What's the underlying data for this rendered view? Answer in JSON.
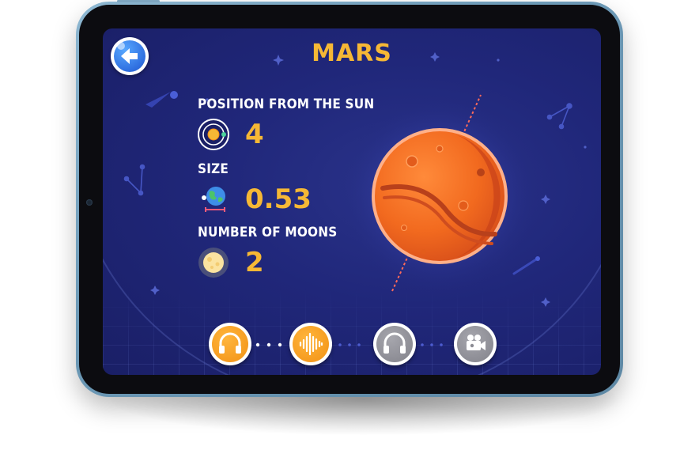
{
  "screen": {
    "title": "MARS",
    "back_icon": "arrow-left-icon",
    "stats": [
      {
        "label": "POSITION FROM THE SUN",
        "value": "4",
        "icon": "orbit-sun-icon"
      },
      {
        "label": "SIZE",
        "value": "0.53",
        "icon": "earth-scale-icon"
      },
      {
        "label": "NUMBER OF MOONS",
        "value": "2",
        "icon": "moon-icon"
      }
    ],
    "planet_icon": "mars-planet-illustration",
    "controls": [
      {
        "icon": "headphones-icon",
        "state": "active",
        "color": "#f59a1e"
      },
      {
        "icon": "audio-wave-icon",
        "state": "active",
        "color": "#f59a1e"
      },
      {
        "icon": "headphones-icon",
        "state": "inactive",
        "color": "#8b8b93"
      },
      {
        "icon": "video-camera-icon",
        "state": "inactive",
        "color": "#8b8b93"
      }
    ]
  },
  "colors": {
    "background": "#20277a",
    "accent": "#f6b835",
    "planet": "#f26a1f",
    "button_active": "#f59a1e",
    "button_inactive": "#8b8b93",
    "back_button": "#2f6fe0"
  }
}
